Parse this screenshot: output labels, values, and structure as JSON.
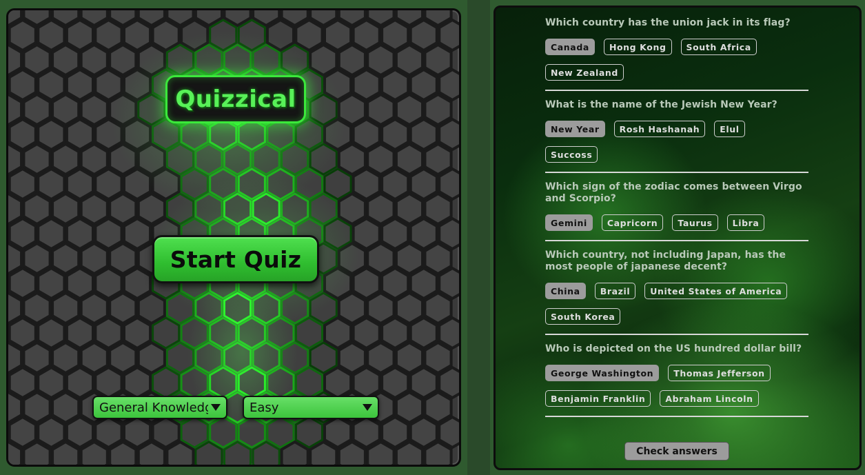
{
  "start_screen": {
    "title": "Quizzical",
    "start_button_label": "Start Quiz",
    "category_select": {
      "selected": "General Knowledge"
    },
    "difficulty_select": {
      "selected": "Easy"
    },
    "accent_color": "#3be83b"
  },
  "quiz": {
    "questions": [
      {
        "text": "Which country has the union jack in its flag?",
        "answers": [
          "Canada",
          "Hong Kong",
          "South Africa",
          "New Zealand"
        ],
        "selected": "Canada"
      },
      {
        "text": "What is the name of the Jewish New Year?",
        "answers": [
          "New Year",
          "Rosh Hashanah",
          "Elul",
          "Succoss"
        ],
        "selected": "New Year"
      },
      {
        "text": "Which sign of the zodiac comes between Virgo and Scorpio?",
        "answers": [
          "Gemini",
          "Capricorn",
          "Taurus",
          "Libra"
        ],
        "selected": "Gemini"
      },
      {
        "text": "Which country, not including Japan, has the most people of japanese decent?",
        "answers": [
          "China",
          "Brazil",
          "United States of America",
          "South Korea"
        ],
        "selected": "China"
      },
      {
        "text": "Who is depicted on the US hundred dollar bill?",
        "answers": [
          "George Washington",
          "Thomas Jefferson",
          "Benjamin Franklin",
          "Abraham Lincoln"
        ],
        "selected": "George Washington"
      }
    ],
    "check_button_label": "Check answers"
  }
}
